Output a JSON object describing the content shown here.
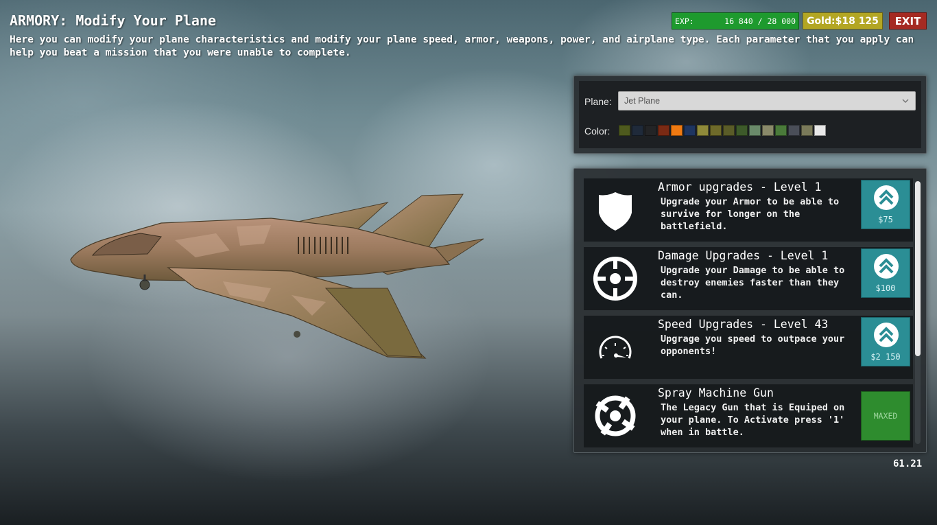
{
  "header": {
    "title": "ARMORY: Modify Your Plane",
    "description": "Here you can modify your plane characteristics and modify your plane speed, armor, weapons, power, and airplane type. Each parameter that you apply can help you beat a mission that you were unable to complete."
  },
  "hud": {
    "exp_label": "EXP:",
    "exp_value": "16 840 / 28 000",
    "gold_label": "Gold:",
    "gold_value": "$18 125",
    "exit_label": "EXIT"
  },
  "plane_panel": {
    "plane_label": "Plane:",
    "plane_selected": "Jet Plane",
    "color_label": "Color:",
    "colors": [
      "#4e5a1e",
      "#1f2a3a",
      "#232426",
      "#7a2a14",
      "#f07a12",
      "#1e3560",
      "#8f8a3a",
      "#6e6a2a",
      "#5a5c28",
      "#3d5a2a",
      "#6a8a6a",
      "#8a8a6a",
      "#4a7a3a",
      "#4a4e58",
      "#7a7a5a",
      "#e8e8e8"
    ]
  },
  "upgrades": [
    {
      "title": "Armor upgrades - Level 1",
      "description": "Upgrade your Armor to be able to survive for longer on the battlefield.",
      "icon": "shield-icon",
      "price": "$75"
    },
    {
      "title": "Damage Upgrades - Level 1",
      "description": "Upgrade your Damage to be able to destroy enemies faster than they can.",
      "icon": "crosshair-icon",
      "price": "$100"
    },
    {
      "title": "Speed Upgrades - Level 43",
      "description": "Upgrage you speed to outpace your opponents!",
      "icon": "speedometer-icon",
      "price": "$2 150"
    },
    {
      "title": "Spray Machine Gun",
      "description": "The Legacy Gun that is Equiped on your plane. To Activate press '1' when in battle.",
      "icon": "gun-target-icon",
      "status": "MAXED"
    }
  ],
  "fps": "61.21",
  "colors": {
    "exp_bar": "#1e9a2e",
    "gold": "#b3a623",
    "exit": "#a52a22",
    "upgrade_button": "#2b8e95",
    "maxed": "#2e8c2e"
  }
}
